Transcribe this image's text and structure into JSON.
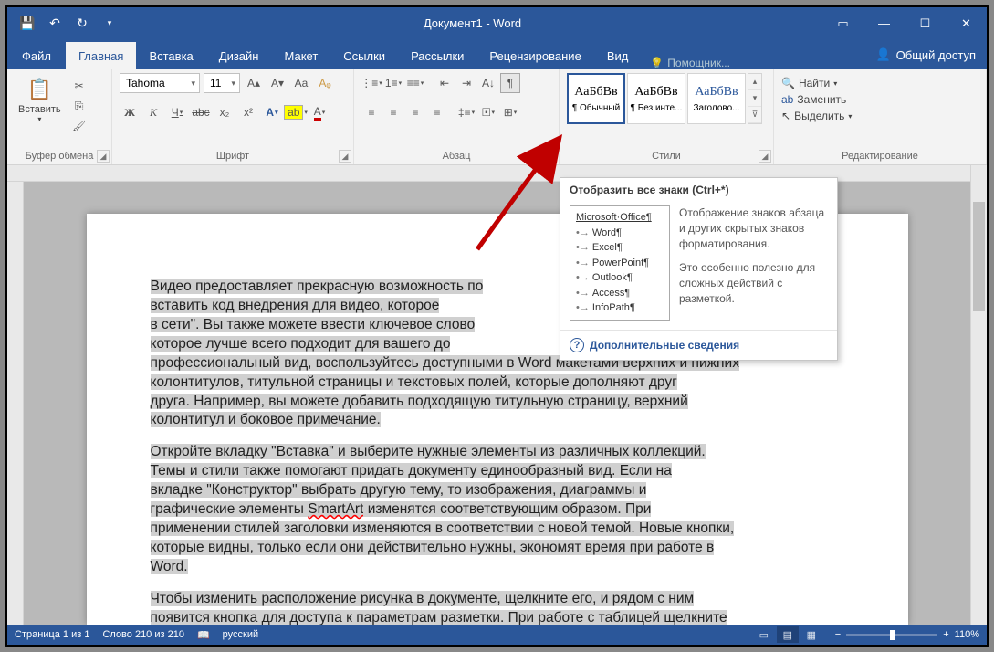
{
  "title": "Документ1 - Word",
  "tabs": {
    "file": "Файл",
    "home": "Главная",
    "insert": "Вставка",
    "design": "Дизайн",
    "layout": "Макет",
    "references": "Ссылки",
    "mailings": "Рассылки",
    "review": "Рецензирование",
    "view": "Вид"
  },
  "tellme": "Помощник...",
  "share": "Общий доступ",
  "groups": {
    "clipboard": {
      "label": "Буфер обмена",
      "paste": "Вставить"
    },
    "font": {
      "label": "Шрифт",
      "face": "Tahoma",
      "size": "11",
      "buttons": {
        "b": "Ж",
        "i": "К",
        "u": "Ч",
        "s": "abc",
        "sub": "x₂",
        "sup": "x²"
      }
    },
    "paragraph": {
      "label": "Абзац"
    },
    "styles": {
      "label": "Стили",
      "items": [
        {
          "sample": "АаБбВв",
          "name": "¶ Обычный"
        },
        {
          "sample": "АаБбВв",
          "name": "¶ Без инте..."
        },
        {
          "sample": "АаБбВв",
          "name": "Заголово..."
        }
      ]
    },
    "editing": {
      "label": "Редактирование",
      "find": "Найти",
      "replace": "Заменить",
      "select": "Выделить"
    }
  },
  "tooltip": {
    "title": "Отобразить все знаки (Ctrl+*)",
    "sample": {
      "heading": "Microsoft·Office¶",
      "items": [
        "Word¶",
        "Excel¶",
        "PowerPoint¶",
        "Outlook¶",
        "Access¶",
        "InfoPath¶"
      ]
    },
    "desc1": "Отображение знаков абзаца и других скрытых знаков форматирования.",
    "desc2": "Это особенно полезно для сложных действий с разметкой.",
    "more": "Дополнительные сведения"
  },
  "document": {
    "p1a": "Видео  предоставляет прекрасную возможность по",
    "p1b": "вставить код  внедрения для видео,       которое ",
    "p1c": "в сети\". Вы  также можете ввести ключевое слово ",
    "p1d": "которое лучше всего подходит     для вашего до",
    "p1e": "профессиональный вид, воспользуйтесь доступными в Word макетами верхних и нижних",
    "p1f": "колонтитулов,       титульной страницы и текстовых   полей, которые дополняют друг",
    "p1g": "друга. Например,     вы можете добавить подходящую  титульную страницу, верхний",
    "p1h": "колонтитул и боковое примечание. ",
    "p2a": "Откройте       вкладку \"Вставка\" и выберите нужные элементы из различных коллекций.",
    "p2b": "              Темы и стили также помогают придать документу единообразный вид.       Если на",
    "p2c": "вкладке \"Конструктор\"       выбрать другую тему, то изображения, диаграммы и",
    "p2d_pre": "графические элементы       ",
    "p2d_err": "SmartArt",
    "p2d_post": " изменятся соответствующим образом. При",
    "p2e": "применении стилей заголовки изменяются в соответствии с новой темой. Новые кнопки,",
    "p2f": "которые видны, только если         они действительно нужны, экономят время при работе в",
    "p2g": "Word. ",
    "p3a": "Чтобы изменить     расположение рисунка в документе,        щелкните его, и рядом с ним",
    "p3b": "появится кнопка для доступа к параметрам разметки.   При работе с таблицей щелкните"
  },
  "status": {
    "page": "Страница 1 из 1",
    "words": "Слово 210 из 210",
    "lang": "русский",
    "zoom": "110%"
  }
}
